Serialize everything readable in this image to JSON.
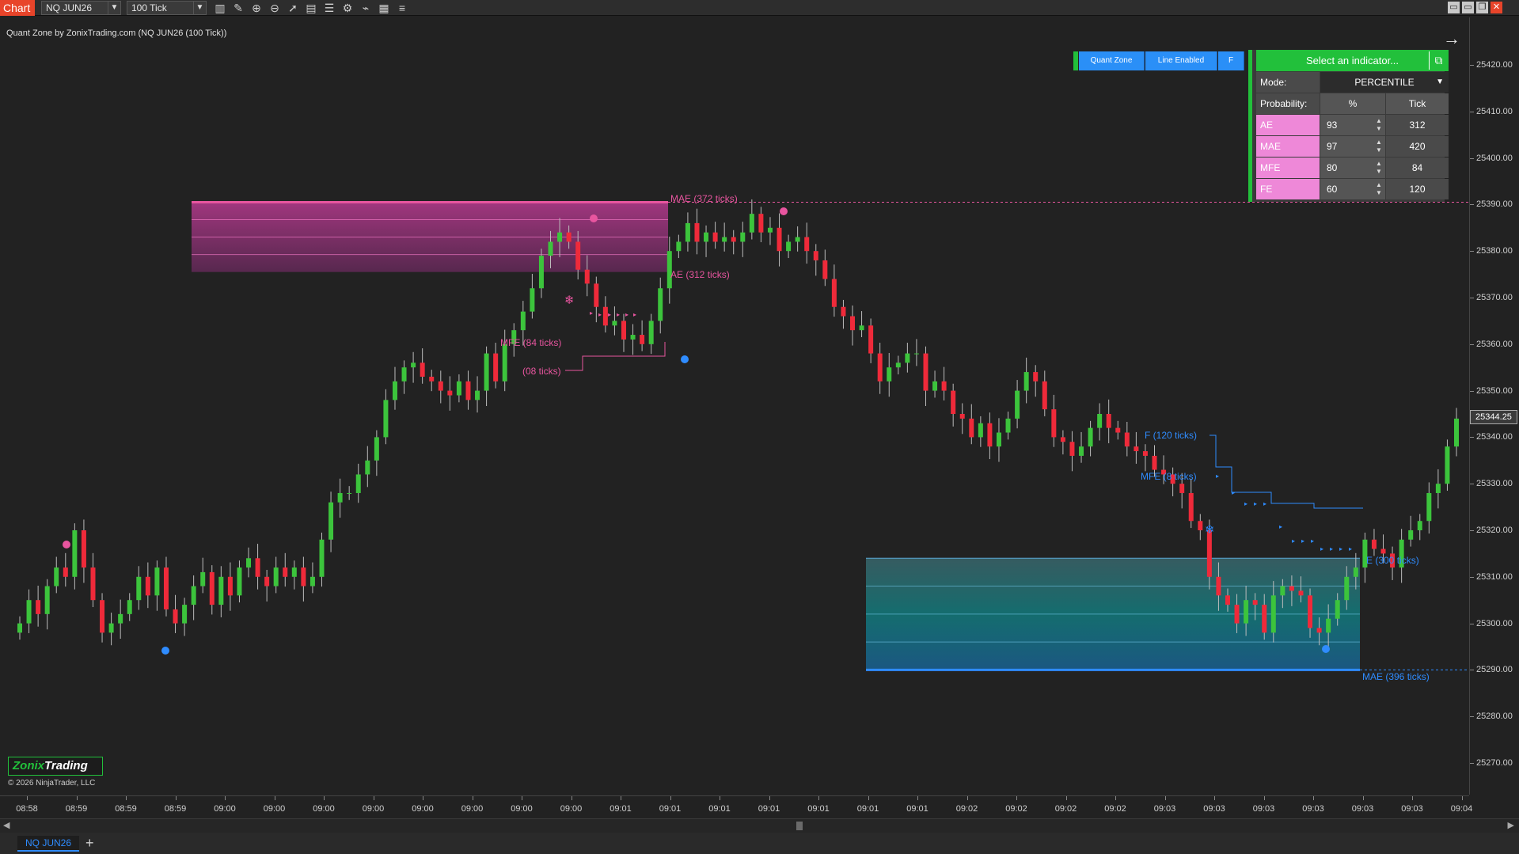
{
  "toolbar": {
    "chart_tab": "Chart",
    "instrument": "NQ JUN26",
    "interval": "100 Tick",
    "icons": [
      "bar-type-icon",
      "pencil-icon",
      "zoom-in-icon",
      "zoom-out-icon",
      "pointer-icon",
      "data-box-icon",
      "properties-icon",
      "strategy-icon",
      "indicator-icon",
      "chart-trader-icon",
      "list-icon"
    ],
    "window_buttons": [
      "restore-icon",
      "minimize-icon",
      "maximize-icon",
      "close-icon"
    ]
  },
  "chart_title": "Quant Zone by ZonixTrading.com (NQ JUN26 (100 Tick))",
  "controls": {
    "quant_zone": "Quant Zone",
    "line_enabled": "Line Enabled",
    "f_button": "F"
  },
  "indicator_panel": {
    "header": "Select an indicator...",
    "mode_label": "Mode:",
    "mode_value": "PERCENTILE",
    "probability_label": "Probability:",
    "pct_header": "%",
    "tick_header": "Tick",
    "rows": [
      {
        "label": "AE",
        "pct": "93",
        "tick": "312"
      },
      {
        "label": "MAE",
        "pct": "97",
        "tick": "420"
      },
      {
        "label": "MFE",
        "pct": "80",
        "tick": "84"
      },
      {
        "label": "FE",
        "pct": "60",
        "tick": "120"
      }
    ]
  },
  "price_axis": {
    "labels": [
      "25420.00",
      "25410.00",
      "25400.00",
      "25390.00",
      "25380.00",
      "25370.00",
      "25360.00",
      "25350.00",
      "25340.00",
      "25330.00",
      "25320.00",
      "25310.00",
      "25300.00",
      "25290.00",
      "25280.00",
      "25270.00"
    ],
    "current_price": "25344.25",
    "corner_label": "F"
  },
  "time_axis": {
    "labels": [
      "08:58",
      "08:59",
      "08:59",
      "08:59",
      "09:00",
      "09:00",
      "09:00",
      "09:00",
      "09:00",
      "09:00",
      "09:00",
      "09:00",
      "09:01",
      "09:01",
      "09:01",
      "09:01",
      "09:01",
      "09:01",
      "09:01",
      "09:02",
      "09:02",
      "09:02",
      "09:02",
      "09:03",
      "09:03",
      "09:03",
      "09:03",
      "09:03",
      "09:03",
      "09:04"
    ]
  },
  "zone_labels": {
    "pink_mae": "MAE (372 ticks)",
    "pink_ae": "AE (312 ticks)",
    "pink_mfe": "MFE (84 ticks)",
    "pink_fe": "(08 ticks)",
    "blue_fe": "F (120 ticks)",
    "blue_mfe": "MFE (8 ticks)",
    "blue_ae": "E (300 ticks)",
    "blue_mae": "MAE (396 ticks)"
  },
  "colors": {
    "up": "#3cc43c",
    "down": "#ef2a3a",
    "pink": "#e8559f",
    "blue": "#2f8cff",
    "green": "#22c03b"
  },
  "bottom_tabs": {
    "active": "NQ JUN26",
    "add": "+"
  },
  "logo": {
    "part1": "Zonix",
    "part2": "Trading"
  },
  "copyright": "© 2026 NinjaTrader, LLC",
  "chart_data": {
    "type": "candlestick",
    "ylim": [
      25265,
      25425
    ],
    "closes": [
      25300,
      25305,
      25302,
      25308,
      25312,
      25310,
      25320,
      25312,
      25305,
      25298,
      25300,
      25302,
      25305,
      25310,
      25306,
      25312,
      25303,
      25300,
      25304,
      25308,
      25311,
      25304,
      25310,
      25306,
      25312,
      25314,
      25310,
      25308,
      25312,
      25310,
      25312,
      25308,
      25310,
      25318,
      25326,
      25328,
      25328,
      25332,
      25335,
      25340,
      25348,
      25352,
      25355,
      25356,
      25353,
      25352,
      25350,
      25349,
      25352,
      25348,
      25350,
      25358,
      25352,
      25360,
      25363,
      25367,
      25372,
      25379,
      25382,
      25384,
      25382,
      25376,
      25373,
      25368,
      25364,
      25365,
      25361,
      25362,
      25360,
      25365,
      25372,
      25380,
      25382,
      25386,
      25382,
      25384,
      25382,
      25383,
      25382,
      25384,
      25388,
      25384,
      25385,
      25380,
      25382,
      25383,
      25380,
      25378,
      25374,
      25368,
      25366,
      25363,
      25364,
      25358,
      25352,
      25355,
      25356,
      25358,
      25358,
      25350,
      25352,
      25350,
      25345,
      25344,
      25340,
      25343,
      25338,
      25341,
      25344,
      25350,
      25354,
      25352,
      25346,
      25340,
      25339,
      25336,
      25338,
      25342,
      25345,
      25342,
      25341,
      25338,
      25337,
      25336,
      25333,
      25332,
      25330,
      25328,
      25322,
      25320,
      25310,
      25306,
      25304,
      25300,
      25305,
      25304,
      25298,
      25306,
      25308,
      25307,
      25306,
      25299,
      25298,
      25301,
      25305,
      25310,
      25312,
      25318,
      25316,
      25315,
      25312,
      25318,
      25320,
      25322,
      25328,
      25330,
      25338,
      25344
    ]
  }
}
